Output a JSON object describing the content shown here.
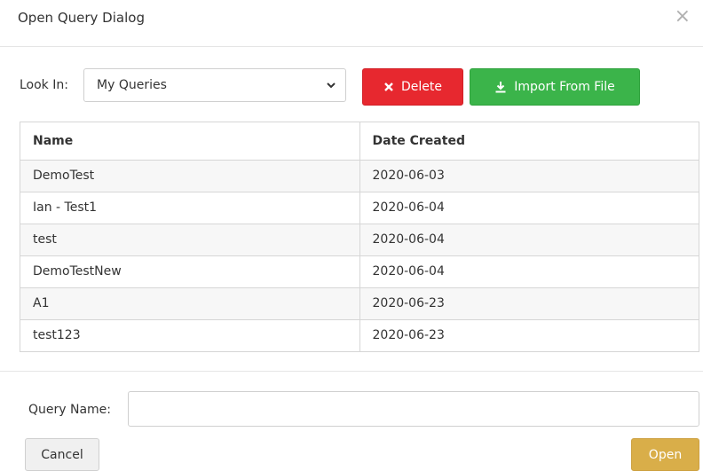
{
  "dialog": {
    "title": "Open Query Dialog",
    "close_icon": "close-icon"
  },
  "toolbar": {
    "look_in_label": "Look In:",
    "look_in_value": "My Queries",
    "delete_label": "Delete",
    "import_label": "Import From File"
  },
  "table": {
    "headers": [
      "Name",
      "Date Created"
    ],
    "rows": [
      [
        "DemoTest",
        "2020-06-03"
      ],
      [
        "Ian - Test1",
        "2020-06-04"
      ],
      [
        "test",
        "2020-06-04"
      ],
      [
        "DemoTestNew",
        "2020-06-04"
      ],
      [
        "A1",
        "2020-06-23"
      ],
      [
        "test123",
        "2020-06-23"
      ]
    ]
  },
  "footer": {
    "query_name_label": "Query Name:",
    "query_name_value": "",
    "cancel_label": "Cancel",
    "open_label": "Open"
  },
  "colors": {
    "delete": "#e7282f",
    "import": "#3bb44a",
    "open": "#d9ae49"
  }
}
